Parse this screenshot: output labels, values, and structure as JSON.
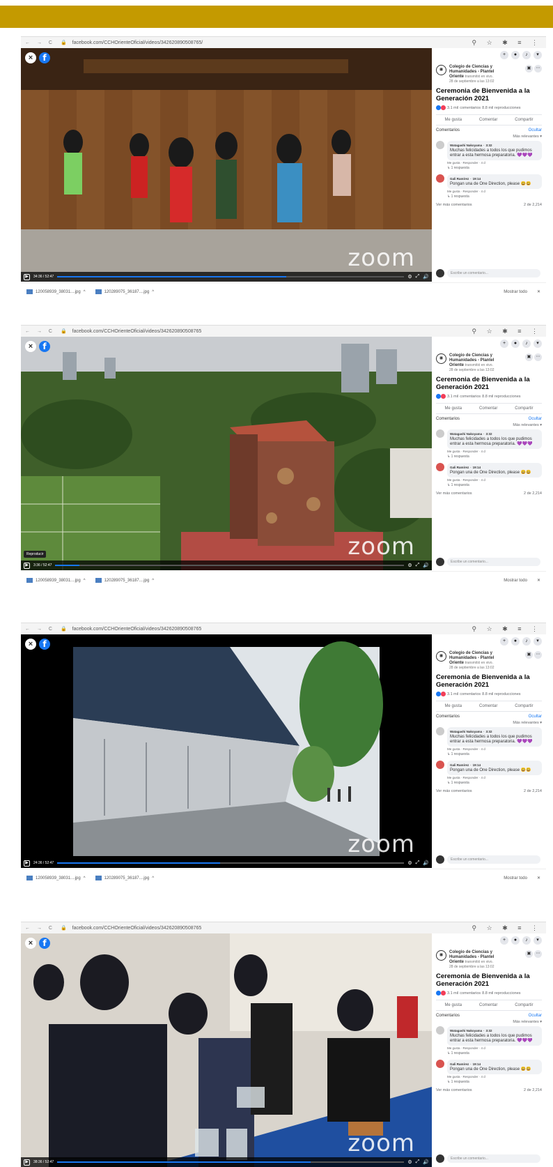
{
  "browser": {
    "url": "facebook.com/CCHOrienteOficial/videos/342620890508765/",
    "url_short": "facebook.com/CCHOrienteOficial/videos/342620890508765"
  },
  "video": {
    "watermark": "zoom",
    "fb_glyph": "f",
    "close_glyph": "×",
    "tooltip": "Reproducir"
  },
  "panel": {
    "page_name": "Colegio de Ciencias y Humanidades - Plantel",
    "page_campus": "Oriente",
    "page_status": "transmitió en vivo.",
    "page_date": "28 de septiembre a las 13:02",
    "title": "Ceremonia de Bienvenida a la Generación 2021",
    "reactions_count": "3.1 mil",
    "comments_count": "comentarios",
    "views": "8.8 mil reproducciones",
    "actions": {
      "like": "Me gusta",
      "comment": "Comentar",
      "share": "Compartir"
    },
    "comments_label": "Comentarios",
    "hide_label": "Ocultar",
    "sort_label": "Más relevantes",
    "comments": [
      {
        "author": "Watagashi Nakoyama",
        "time": "3:32",
        "text": "Muchas felicidades a todos los que pudimos entrar a esta hermosa preparatoria. 💜💜💜",
        "meta": "Me gusta · Responder · 4 d",
        "replies": "1 respuesta"
      },
      {
        "author": "Gali Ramírez",
        "time": "19:14",
        "text": "Pongan una de One Direction, please 😃😃",
        "meta": "Me gusta · Responder · 4 d",
        "replies": "1 respuesta"
      }
    ],
    "more_comments": "Ver más comentarios",
    "comment_counter": "2 de 2,214",
    "write_placeholder": "Escribe un comentario..."
  },
  "downloads": {
    "file1": "120058939_38031....jpg",
    "file2": "120289075_36187....jpg",
    "show_all": "Mostrar todo"
  },
  "screens": [
    {
      "time": "34:36 / 52:47",
      "progress": 0.66
    },
    {
      "time": "3:36 / 52:47",
      "progress": 0.07
    },
    {
      "time": "24:36 / 52:47",
      "progress": 0.47
    },
    {
      "time": "38:36 / 52:47",
      "progress": 0.73
    }
  ],
  "colors": {
    "band": "#c49a00",
    "fb_blue": "#1877f2"
  }
}
